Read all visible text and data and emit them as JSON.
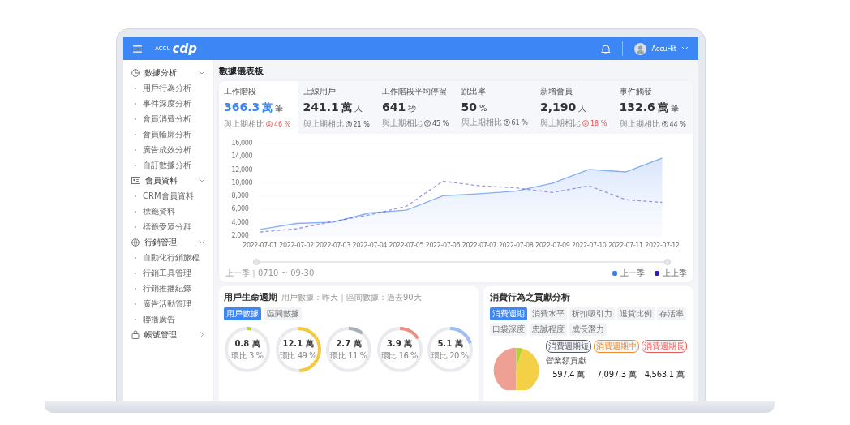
{
  "header": {
    "logo_prefix": "ACCU",
    "logo_main": "cdp",
    "user": "AccuHit"
  },
  "sidebar": [
    {
      "label": "數據分析",
      "kind": "pie",
      "expanded": true,
      "children": [
        {
          "label": "用戶行為分析"
        },
        {
          "label": "事件深度分析"
        },
        {
          "label": "會員消費分析"
        },
        {
          "label": "會員輪廓分析"
        },
        {
          "label": "廣告成效分析"
        },
        {
          "label": "自訂數據分析"
        }
      ]
    },
    {
      "label": "會員資料",
      "kind": "card",
      "expanded": true,
      "children": [
        {
          "label": "CRM會員資料"
        },
        {
          "label": "標籤資料"
        },
        {
          "label": "標籤受眾分群"
        }
      ]
    },
    {
      "label": "行銷管理",
      "kind": "globe",
      "expanded": true,
      "children": [
        {
          "label": "自動化行銷旅程"
        },
        {
          "label": "行銷工具管理"
        },
        {
          "label": "行銷推播紀錄"
        },
        {
          "label": "廣告活動管理"
        },
        {
          "label": "聯播廣告"
        }
      ]
    },
    {
      "label": "帳號管理",
      "kind": "lock",
      "expanded": false
    }
  ],
  "page_title": "數據儀表板",
  "stats": [
    {
      "label": "工作階段",
      "value": "366.3",
      "unit_big": "萬",
      "unit": "筆",
      "compare_label": "與上期相比",
      "change": "46 %",
      "kind": "down",
      "selected": true
    },
    {
      "label": "上線用戶",
      "value": "241.1",
      "unit_big": "萬",
      "unit": "人",
      "compare_label": "與上期相比",
      "change": "21 %",
      "kind": "up",
      "selected": false
    },
    {
      "label": "工作階段平均停留",
      "value": "641",
      "unit": "秒",
      "compare_label": "與上期相比",
      "change": "45 %",
      "kind": "up",
      "selected": false
    },
    {
      "label": "跳出率",
      "value": "50",
      "unit": "%",
      "compare_label": "與上期相比",
      "change": "61 %",
      "kind": "up",
      "selected": false
    },
    {
      "label": "新增會員",
      "value": "2,190",
      "unit": "人",
      "compare_label": "與上期相比",
      "change": "18 %",
      "kind": "down",
      "selected": false
    },
    {
      "label": "事件觸發",
      "value": "132.6",
      "unit_big": "萬",
      "unit": "筆",
      "compare_label": "與上期相比",
      "change": "44 %",
      "kind": "up",
      "selected": false
    }
  ],
  "chart_data": {
    "type": "line",
    "categories": [
      "2022-07-01",
      "2022-07-02",
      "2022-07-03",
      "2022-07-04",
      "2022-07-05",
      "2022-07-06",
      "2022-07-07",
      "2022-07-08",
      "2022-07-09",
      "2022-07-10",
      "2022-07-11",
      "2022-07-12"
    ],
    "series": [
      {
        "name": "上一季",
        "color": "#3b7ef0",
        "type": "area",
        "line_style": "solid",
        "values": [
          3000,
          3900,
          4100,
          5500,
          5900,
          8100,
          8400,
          8800,
          10000,
          12100,
          11700,
          13800
        ]
      },
      {
        "name": "上上季",
        "color": "#2a1fb8",
        "type": "line",
        "line_style": "dashed",
        "values": [
          2600,
          3100,
          4200,
          5200,
          6500,
          10300,
          9600,
          9300,
          8600,
          9600,
          7500,
          7100
        ]
      }
    ],
    "grid": true,
    "legend": "lower right",
    "ylim": [
      2000,
      16000
    ],
    "yticks": [
      {
        "value": 2000,
        "label": "2,000"
      },
      {
        "value": 4000,
        "label": "4,000"
      },
      {
        "value": 6000,
        "label": "6,000"
      },
      {
        "value": 8000,
        "label": "8,000"
      },
      {
        "value": 10000,
        "label": "10,000"
      },
      {
        "value": 12000,
        "label": "12,000"
      },
      {
        "value": 14000,
        "label": "14,000"
      },
      {
        "value": 16000,
        "label": "16,000"
      }
    ]
  },
  "range_label": "上一季｜0710 ~ 09-30",
  "lifecycle": {
    "title": "用戶生命週期",
    "subtitle": "用戶數據：昨天｜區間數據：過去90天",
    "tabs": [
      {
        "label": "用戶數據",
        "selected": true
      },
      {
        "label": "區間數據",
        "selected": false
      }
    ],
    "rings": [
      {
        "value": "0.8",
        "unit": "萬",
        "ratio": "環比 3 %",
        "level": 0.03,
        "color": "#b5d334"
      },
      {
        "value": "12.1",
        "unit": "萬",
        "ratio": "環比 49 %",
        "level": 0.49,
        "color": "#f5c842"
      },
      {
        "value": "2.7",
        "unit": "萬",
        "ratio": "環比 11 %",
        "level": 0.11,
        "color": "#a9adb5"
      },
      {
        "value": "3.9",
        "unit": "萬",
        "ratio": "環比 16 %",
        "level": 0.16,
        "color": "#ef8f82"
      },
      {
        "value": "5.1",
        "unit": "萬",
        "ratio": "環比 20 %",
        "level": 0.2,
        "color": "#9dbff5"
      }
    ]
  },
  "contribution": {
    "title": "消費行為之貢獻分析",
    "tabs": [
      {
        "label": "消費週期",
        "selected": true
      },
      {
        "label": "消費水平",
        "selected": false
      },
      {
        "label": "折扣吸引力",
        "selected": false
      },
      {
        "label": "退貨比例",
        "selected": false
      },
      {
        "label": "存活率",
        "selected": false
      },
      {
        "label": "口袋深度",
        "selected": false
      },
      {
        "label": "忠誠程度",
        "selected": false
      },
      {
        "label": "成長潛力",
        "selected": false
      }
    ],
    "pills": [
      {
        "label": "消費週期短",
        "color": "#555b66"
      },
      {
        "label": "消費週期中",
        "color": "#f08a24"
      },
      {
        "label": "消費週期長",
        "color": "#ef5b5b"
      }
    ],
    "row_label": "營業額貢獻",
    "values": [
      "597.4 萬",
      "7,097.3 萬",
      "4,563.1 萬"
    ]
  }
}
